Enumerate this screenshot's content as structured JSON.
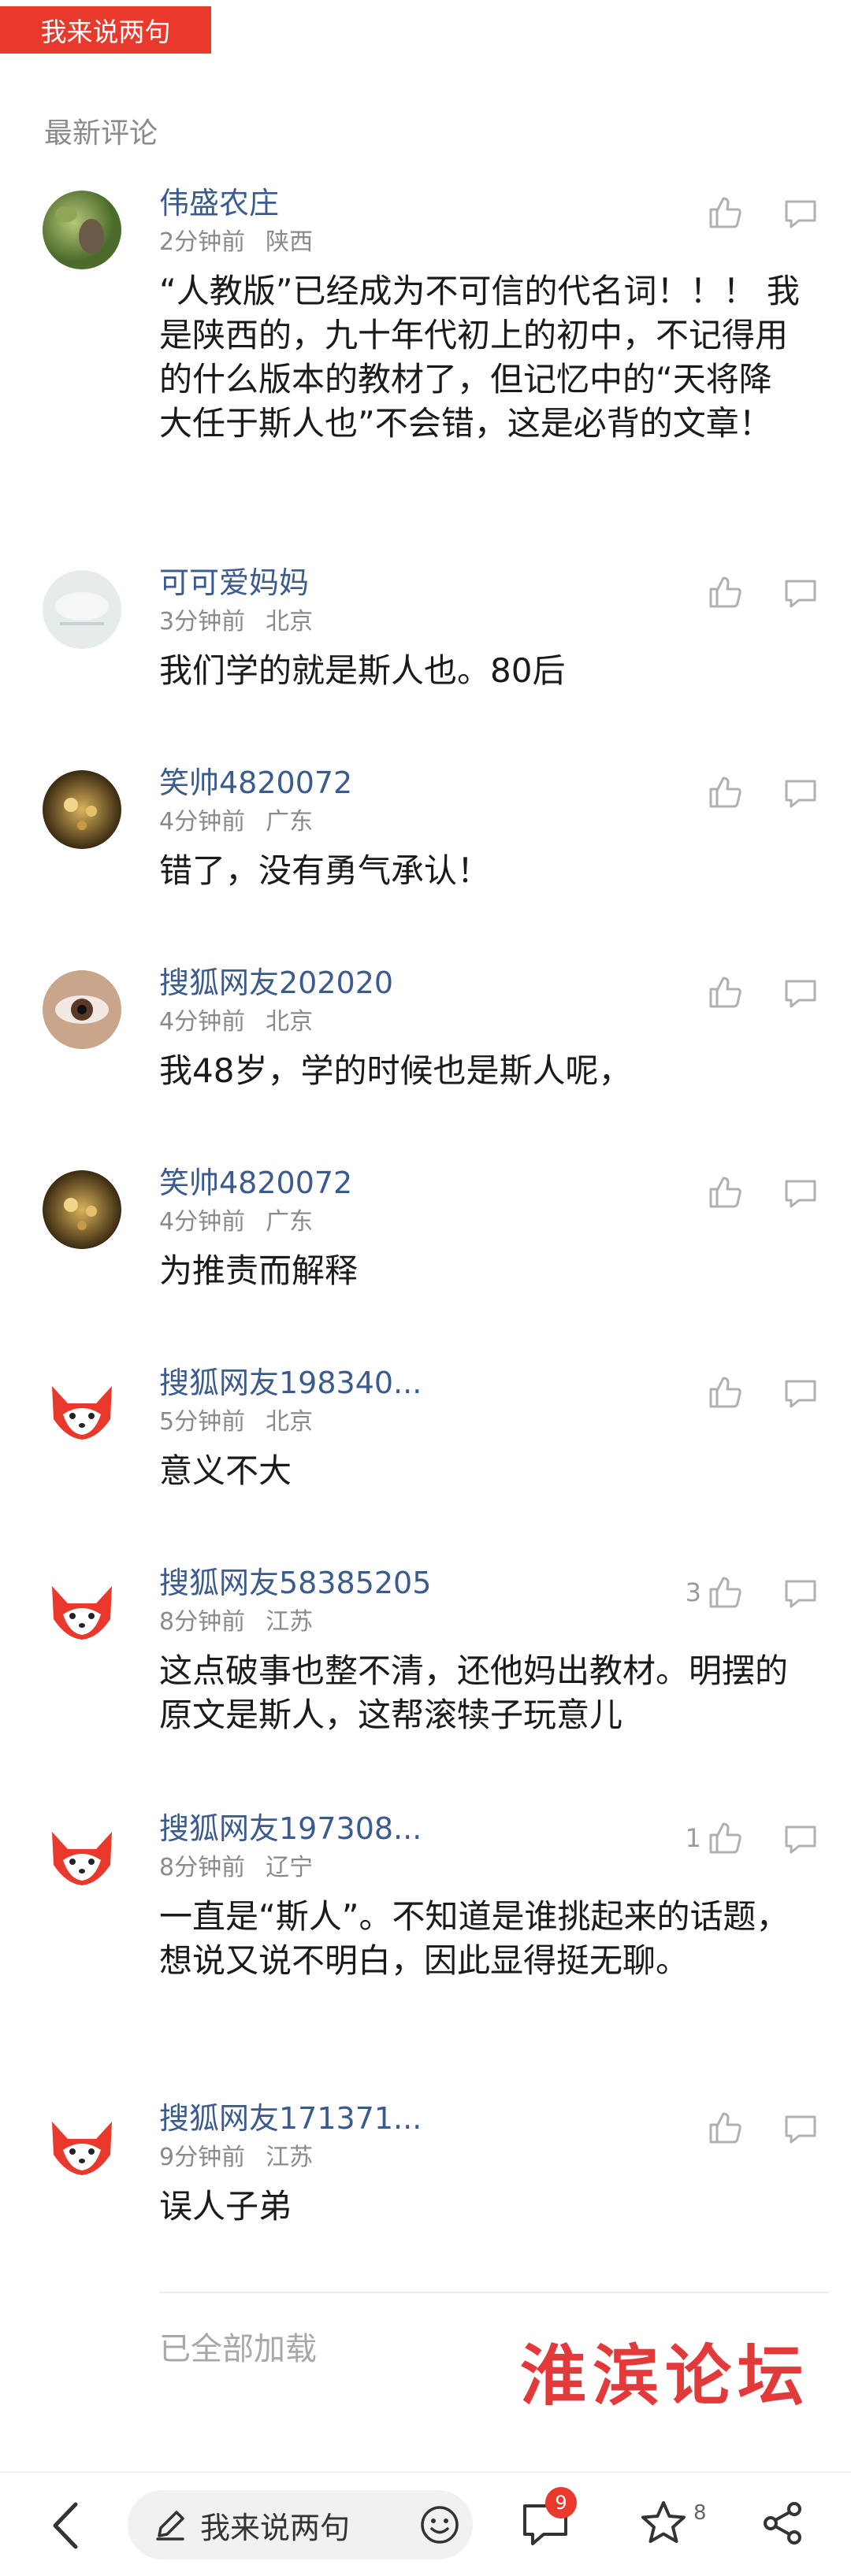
{
  "top_button": {
    "label": "我来说两句"
  },
  "section_title": "最新评论",
  "comments": [
    {
      "name": "伟盛农庄",
      "time": "2分钟前",
      "location": "陕西",
      "content": "“人教版”已经成为不可信的代名词！！！ 我是陕西的，九十年代初上的初中，不记得用的什么版本的教材了，但记忆中的“天将降大任于斯人也”不会错，这是必背的文章！",
      "likes": "",
      "avatar": "photo-green"
    },
    {
      "name": "可可爱妈妈",
      "time": "3分钟前",
      "location": "北京",
      "content": "我们学的就是斯人也。80后",
      "likes": "",
      "avatar": "photo-light"
    },
    {
      "name": "笑帅4820072",
      "time": "4分钟前",
      "location": "广东",
      "content": "错了，没有勇气承认！",
      "likes": "",
      "avatar": "photo-gold"
    },
    {
      "name": "搜狐网友202020",
      "time": "4分钟前",
      "location": "北京",
      "content": "我48岁，学的时候也是斯人呢，",
      "likes": "",
      "avatar": "photo-eye"
    },
    {
      "name": "笑帅4820072",
      "time": "4分钟前",
      "location": "广东",
      "content": "为推责而解释",
      "likes": "",
      "avatar": "photo-gold"
    },
    {
      "name": "搜狐网友198340...",
      "time": "5分钟前",
      "location": "北京",
      "content": "意义不大",
      "likes": "",
      "avatar": "fox"
    },
    {
      "name": "搜狐网友58385205",
      "time": "8分钟前",
      "location": "江苏",
      "content": "这点破事也整不清，还他妈出教材。明摆的原文是斯人，这帮滚犊子玩意儿",
      "likes": "3",
      "avatar": "fox"
    },
    {
      "name": "搜狐网友197308...",
      "time": "8分钟前",
      "location": "辽宁",
      "content": "一直是“斯人”。不知道是谁挑起来的话题，想说又说不明白，因此显得挺无聊。",
      "likes": "1",
      "avatar": "fox"
    },
    {
      "name": "搜狐网友171371...",
      "time": "9分钟前",
      "location": "江苏",
      "content": "误人子弟",
      "likes": "",
      "avatar": "fox"
    }
  ],
  "all_loaded": "已全部加载",
  "watermark": "淮滨论坛",
  "bottom_bar": {
    "input_label": "我来说两句",
    "comment_badge": "9",
    "favorite_count": "8"
  },
  "colors": {
    "accent": "#e8392c",
    "username": "#3b5b8f",
    "meta": "#8a8a8a"
  }
}
